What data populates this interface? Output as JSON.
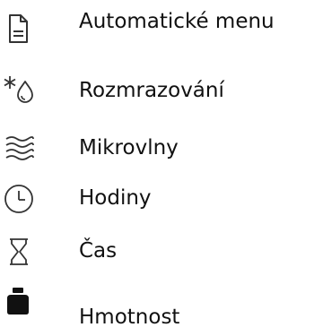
{
  "menu": {
    "items": [
      {
        "icon": "document-icon",
        "label": "Automatické menu"
      },
      {
        "icon": "defrost-icon",
        "label": "Rozmrazování"
      },
      {
        "icon": "microwave-waves-icon",
        "label": "Mikrovlny"
      },
      {
        "icon": "clock-icon",
        "label": "Hodiny"
      },
      {
        "icon": "hourglass-icon",
        "label": "Čas"
      },
      {
        "icon": "weight-icon",
        "label": "Hmotnost"
      }
    ]
  },
  "colors": {
    "text": "#111111",
    "icon_stroke": "#333333",
    "background": "#ffffff"
  }
}
